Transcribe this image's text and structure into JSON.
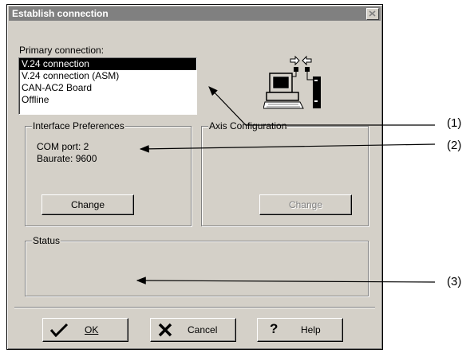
{
  "dialog": {
    "title": "Establish connection",
    "primary_label": "Primary connection:",
    "connections": [
      "V.24 connection",
      "V.24 connection (ASM)",
      "CAN-AC2 Board",
      "Offline"
    ],
    "selected_index": 0,
    "interface": {
      "label": "Interface Preferences",
      "com_port": "COM port: 2",
      "baudrate": "Baurate: 9600",
      "change": "Change"
    },
    "axis": {
      "label": "Axis Configuration",
      "change": "Change"
    },
    "status": {
      "label": "Status"
    },
    "buttons": {
      "ok": "OK",
      "cancel": "Cancel",
      "help": "Help"
    }
  },
  "callouts": [
    "(1)",
    "(2)",
    "(3)"
  ]
}
